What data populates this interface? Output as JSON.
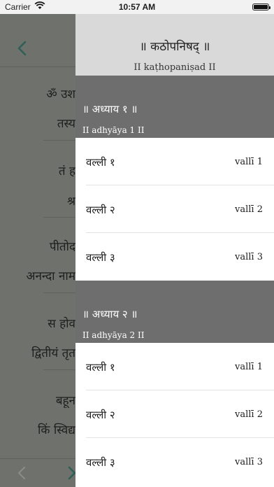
{
  "status_bar": {
    "carrier": "Carrier",
    "time": "10:57 AM"
  },
  "background": {
    "verses": [
      "ॐ उश",
      "तस्य",
      "तं ह",
      "श्र",
      "पीतोद",
      "अनन्दा नाम",
      "स होव",
      "द्वितीयं तृत",
      "बहून",
      "किं स्विद्य"
    ]
  },
  "drawer": {
    "title": "॥ कठोपनिषद् ॥",
    "subtitle": "II kaṭhopaniṣad II",
    "sections": [
      {
        "title": "॥ अध्याय १ ॥",
        "subtitle": "II adhyāya 1 II",
        "items": [
          {
            "label": "वल्ली १",
            "trans": "vallī 1"
          },
          {
            "label": "वल्ली २",
            "trans": "vallī 2"
          },
          {
            "label": "वल्ली ३",
            "trans": "vallī 3"
          }
        ]
      },
      {
        "title": "॥ अध्याय २ ॥",
        "subtitle": "II adhyāya 2 II",
        "items": [
          {
            "label": "वल्ली १",
            "trans": "vallī 1"
          },
          {
            "label": "वल्ली २",
            "trans": "vallī 2"
          },
          {
            "label": "वल्ली ३",
            "trans": "vallī 3"
          }
        ]
      }
    ]
  },
  "colors": {
    "dim_overlay": "#6f716d",
    "accent": "#2f5f55",
    "section_bg": "#6e6e6e",
    "header_bg": "#d9d9d9"
  },
  "icons": {
    "back": "chevron-left-icon",
    "prev": "chevron-left-icon",
    "next": "chevron-right-icon",
    "wifi": "wifi-icon",
    "battery": "battery-icon"
  }
}
